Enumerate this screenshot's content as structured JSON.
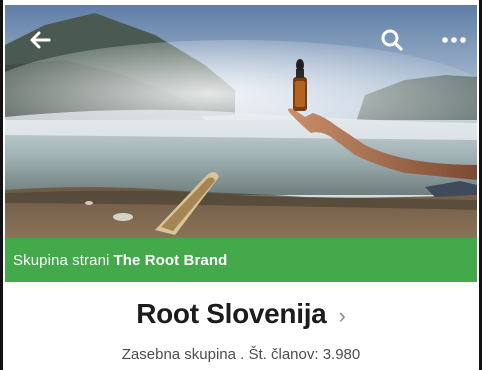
{
  "header": {
    "back_icon": "back-arrow-icon",
    "search_icon": "search-icon",
    "more_icon": "more-dots-icon"
  },
  "banner": {
    "prefix": "Skupina strani",
    "brand": "The Root Brand",
    "color": "#43a94a"
  },
  "group": {
    "name": "Root Slovenija",
    "chevron": "›",
    "meta": "Zasebna skupina . Št. članov: 3.980"
  }
}
